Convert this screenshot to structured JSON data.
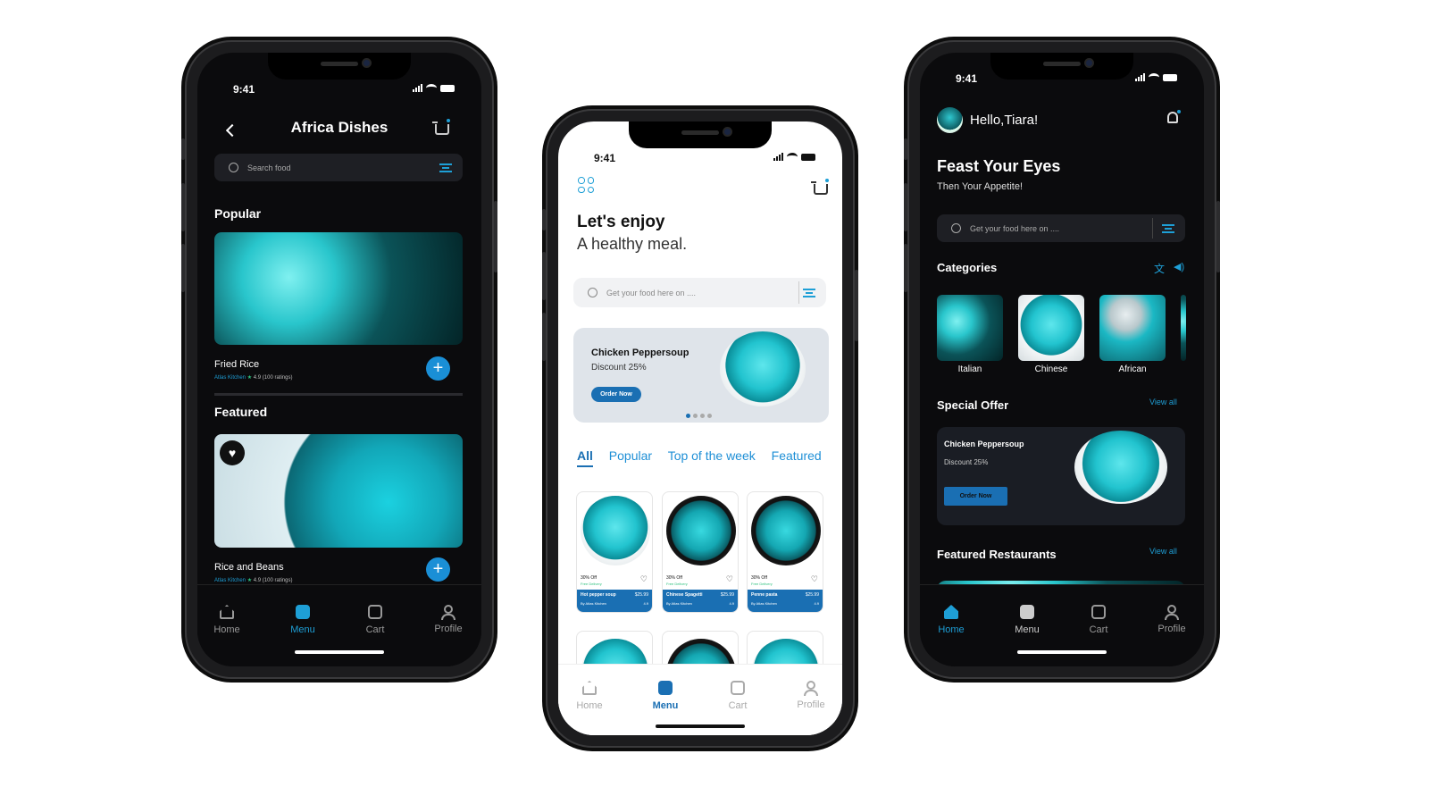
{
  "status": {
    "time": "9:41"
  },
  "colors": {
    "accent": "#1a8fd6",
    "dark_bg": "#0b0b0d",
    "card_dark": "#1a1d24",
    "food_teal": "#22c4cf"
  },
  "left": {
    "title": "Africa Dishes",
    "search_placeholder": "Search food",
    "popular_heading": "Popular",
    "featured_heading": "Featured",
    "items": [
      {
        "name": "Fried Rice",
        "vendor": "Atlas Kitchen",
        "rating": "4.9 (100 ratings)"
      },
      {
        "name": "Rice and Beans",
        "vendor": "Atlas Kitchen",
        "rating": "4.9 (100 ratings)"
      }
    ],
    "tabs": [
      {
        "label": "Home",
        "icon": "home-icon"
      },
      {
        "label": "Menu",
        "icon": "menu-icon",
        "active": true
      },
      {
        "label": "Cart",
        "icon": "cart-icon"
      },
      {
        "label": "Profile",
        "icon": "profile-icon"
      }
    ]
  },
  "center": {
    "heading": "Let's enjoy",
    "subheading": "A healthy meal.",
    "search_placeholder": "Get your food here on ....",
    "promo": {
      "title": "Chicken Peppersoup",
      "discount": "Discount 25%",
      "button": "Order Now"
    },
    "categories": [
      {
        "label": "All",
        "active": true
      },
      {
        "label": "Popular"
      },
      {
        "label": "Top of the week"
      },
      {
        "label": "Featured"
      }
    ],
    "cards": [
      {
        "discount": "30% Off",
        "delivery": "Free Delivery",
        "name": "Hot pepper soup",
        "price": "$25.99",
        "vendor": "By Atlas Kitchen",
        "rating": "4.9"
      },
      {
        "discount": "30% Off",
        "delivery": "Free Delivery",
        "name": "Chinese Spagetti",
        "price": "$25.99",
        "vendor": "By Atlas Kitchen",
        "rating": "4.9"
      },
      {
        "discount": "30% Off",
        "delivery": "Free Delivery",
        "name": "Penne pasta",
        "price": "$25.99",
        "vendor": "By Atlas Kitchen",
        "rating": "4.9"
      }
    ],
    "tabs": [
      {
        "label": "Home"
      },
      {
        "label": "Menu",
        "active": true
      },
      {
        "label": "Cart"
      },
      {
        "label": "Profile"
      }
    ]
  },
  "right": {
    "greeting": "Hello,Tiara!",
    "headline": "Feast Your Eyes",
    "tagline": "Then Your Appetite!",
    "search_placeholder": "Get your food here on ....",
    "categories_heading": "Categories",
    "categories": [
      "Italian",
      "Chinese",
      "African"
    ],
    "special_heading": "Special Offer",
    "view_all": "View all",
    "offer": {
      "title": "Chicken Peppersoup",
      "discount": "Discount 25%",
      "button": "Order Now"
    },
    "featured_heading": "Featured Restaurants",
    "tabs": [
      {
        "label": "Home",
        "active": true
      },
      {
        "label": "Menu"
      },
      {
        "label": "Cart"
      },
      {
        "label": "Profile"
      }
    ]
  }
}
